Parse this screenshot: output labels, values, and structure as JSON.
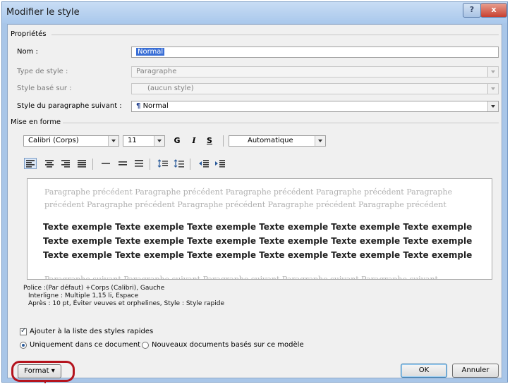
{
  "window": {
    "title": "Modifier le style",
    "help": "?",
    "close": "x"
  },
  "proprietes": {
    "section": "Propriétés",
    "nom_label": "Nom :",
    "nom_value": "Normal",
    "type_label": "Type de style :",
    "type_value": "Paragraphe",
    "base_label": "Style basé sur :",
    "base_value": "(aucun style)",
    "suivant_label": "Style du paragraphe suivant :",
    "suivant_value": "Normal",
    "suivant_icon": "¶"
  },
  "mise_en_forme": {
    "section": "Mise en forme",
    "font": "Calibri (Corps)",
    "size": "11",
    "bold": "G",
    "italic": "I",
    "underline": "S",
    "color": "Automatique"
  },
  "preview": {
    "previous": "Paragraphe précédent Paragraphe précédent Paragraphe précédent Paragraphe précédent Paragraphe précédent Paragraphe précédent Paragraphe précédent Paragraphe précédent Paragraphe précédent",
    "sample": "Texte exemple Texte exemple Texte exemple Texte exemple Texte exemple Texte exemple Texte exemple Texte exemple Texte exemple Texte exemple Texte exemple Texte exemple Texte exemple Texte exemple Texte exemple Texte exemple Texte exemple Texte exemple",
    "following": "Paragraphe suivant Paragraphe suivant Paragraphe suivant Paragraphe suivant Paragraphe suivant"
  },
  "description": {
    "line1": "Police :(Par défaut) +Corps (Calibri), Gauche",
    "line2": "Interligne : Multiple 1,15 li, Espace",
    "line3": "Après : 10 pt, Éviter veuves et orphelines, Style : Style rapide"
  },
  "options": {
    "quick_list": "Ajouter à la liste des styles rapides",
    "only_document": "Uniquement dans ce document",
    "new_documents": "Nouveaux documents basés sur ce modèle"
  },
  "buttons": {
    "format": "Format",
    "format_arrow": "▾",
    "ok": "OK",
    "cancel": "Annuler"
  },
  "colors": {
    "selection": "#3a6fd6",
    "highlight": "#b4141e"
  }
}
